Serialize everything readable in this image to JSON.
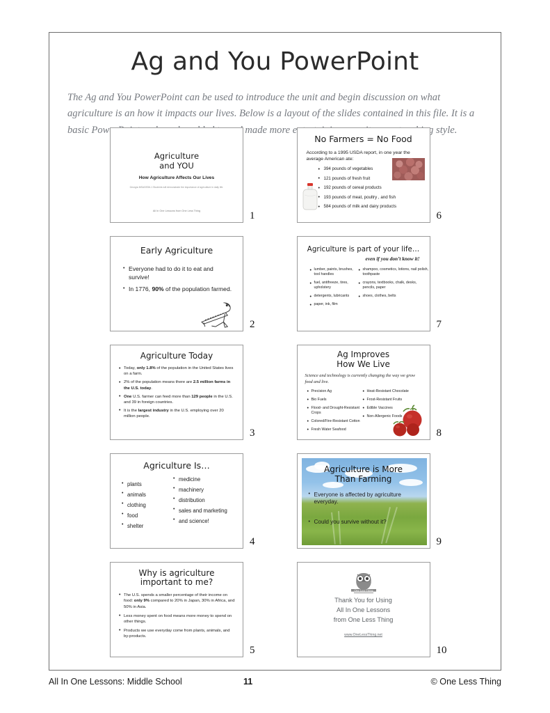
{
  "header": {
    "title": "Ag and You PowerPoint",
    "intro": "The Ag and You PowerPoint can be used to introduce the unit and begin discussion on what agriculture is an how it impacts our lives. Below is a layout of the slides contained in this file. It is a basic PowerPoint and can be added to and made more entertaining as suits your teaching style."
  },
  "slides": [
    {
      "number": "1",
      "title_line1": "Agriculture",
      "title_line2": "and YOU",
      "subtitle": "How Agriculture Affects Our Lives",
      "standard": "Georgia MSAGED6-1 Students will demonstrate the importance of agriculture in daily life.",
      "footer": "All In One Lessons from One Less Thing"
    },
    {
      "number": "2",
      "title": "Early Agriculture",
      "bullets": [
        {
          "pre": "Everyone had to do it to eat and survive!"
        },
        {
          "pre": "In 1776, ",
          "strong": "90%",
          "post": " of the population farmed."
        }
      ],
      "image": "plow-illustration"
    },
    {
      "number": "3",
      "title": "Agriculture Today",
      "bullets": [
        {
          "pre": "Today, ",
          "strong": "only 1.8%",
          "post": " of the population in the United States lives on a farm."
        },
        {
          "pre": "2% of the population means there are ",
          "strong": "2.5 million farms in the U.S. today",
          "post": "."
        },
        {
          "strong": "One",
          "post": " U.S. farmer can feed more than ",
          "strong2": "129 people",
          "post2": " in the U.S. and 39 in foreign countries."
        },
        {
          "pre": "It is the ",
          "strong": "largest industry",
          "post": " in the U.S. employing over 20 million people."
        }
      ]
    },
    {
      "number": "4",
      "title": "Agriculture Is…",
      "column_left": [
        "plants",
        "animals",
        "clothing",
        "food",
        "shelter"
      ],
      "column_right": [
        "medicine",
        "machinery",
        "distribution",
        "sales and marketing",
        "and science!"
      ]
    },
    {
      "number": "5",
      "title_line1": "Why is agriculture",
      "title_line2": "important to me?",
      "bullets": [
        {
          "pre": "The U.S. spends a smaller percentage of their income on food: ",
          "strong": "only 9%",
          "post": " compared to 20% in Japan, 30% in Africa, and 50% in Asia."
        },
        {
          "pre": "Less money spent on food means more money to spend on other things."
        },
        {
          "pre": "Products we use everyday come from plants, animals, and by-products."
        }
      ]
    },
    {
      "number": "6",
      "title": "No Farmers = No Food",
      "lead": "According to a 1995 USDA report, in one year the average American ate:",
      "bullets": [
        "394 pounds of vegetables",
        "121 pounds of fresh fruit",
        "192 pounds of cereal products",
        "193 pounds of meat, poultry , and fish",
        "584 pounds of milk and dairy products"
      ],
      "images": [
        "potatoes-photo",
        "milk-jug-photo"
      ]
    },
    {
      "number": "7",
      "title": "Agriculture is part of your life…",
      "kicker": "even if you don’t know it!",
      "column_left": [
        "lumber, paints, brushes, tool handles",
        "fuel, antifreeze, tires, upholstery",
        "detergents, lubricants",
        "paper, ink, film"
      ],
      "column_right": [
        "shampoo, cosmetics, lotions, nail polish, toothpaste",
        "crayons, textbooks, chalk, desks, pencils, paper",
        "shoes, clothes, belts"
      ]
    },
    {
      "number": "8",
      "title_line1": "Ag Improves",
      "title_line2": "How We Live",
      "kicker": "Science and technology is currently changing the way we grow food and live.",
      "column_left": [
        "Precision Ag",
        "Bio Fuels",
        "Flood- and Drought-Resistant Crops",
        "Colored/Fire-Resistant Cotton",
        "Fresh Water Seafood"
      ],
      "column_right": [
        "Heat-Resistant Chocolate",
        "Frost-Resistant Fruits",
        "Edible Vaccines",
        "Non-Allergenic Foods"
      ],
      "image": "tomatoes-photo"
    },
    {
      "number": "9",
      "title_line1": "Agriculture is More",
      "title_line2": "Than Farming",
      "bullets": [
        "Everyone is affected by agriculture everyday.",
        "Could you survive without it?"
      ],
      "image": "wheat-field-photo"
    },
    {
      "number": "10",
      "logo": "one-less-thing-owl-logo",
      "thanks_line1": "Thank You for Using",
      "thanks_line2": "All In One Lessons",
      "thanks_line3": "from One Less Thing",
      "url": "www.OneLessThing.net"
    }
  ],
  "footer": {
    "left": "All In One Lessons: Middle School",
    "page_number": "11",
    "right": "© One Less Thing"
  },
  "colors": {
    "intro_text": "#767a80",
    "frame_border": "#6d6d6d",
    "slide_border": "#9b9b9b",
    "sky": "#7fb3e0",
    "field": "#7aa83f",
    "tomato": "#c5302a"
  }
}
